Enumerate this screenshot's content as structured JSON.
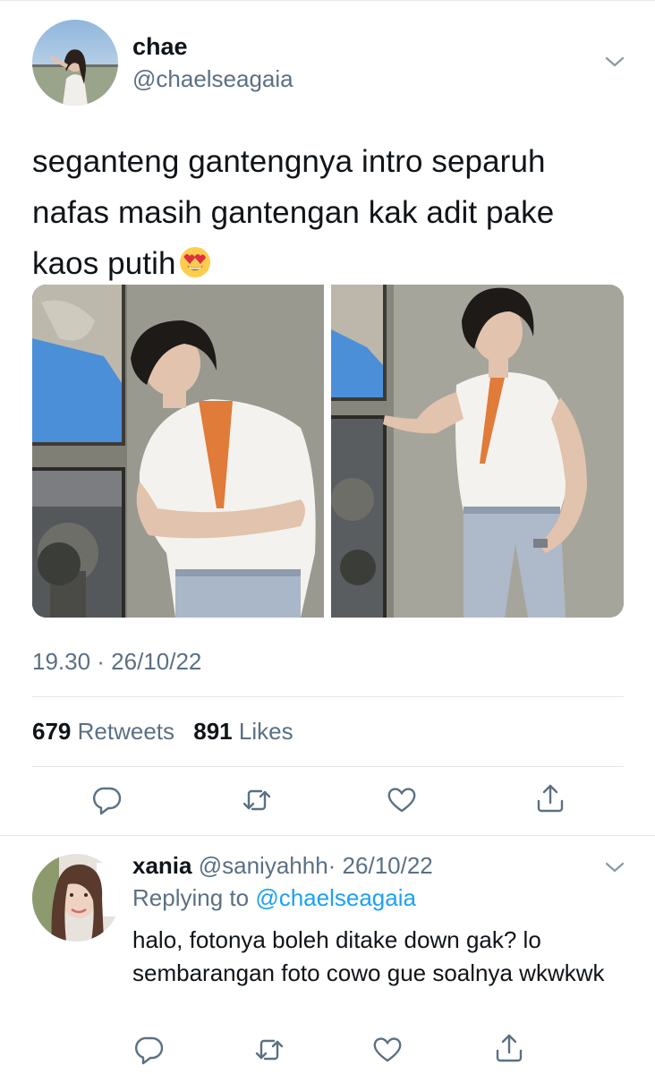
{
  "tweet": {
    "author_name": "chae",
    "author_handle": "@chaelseagaia",
    "text": "seganteng gantengnya intro separuh nafas masih gantengan kak adit pake kaos putih",
    "emoji": "smiling-face-with-heart-eyes",
    "timestamp": "19.30 · 26/10/22",
    "retweets_count": "679",
    "retweets_label": "Retweets",
    "likes_count": "891",
    "likes_label": "Likes"
  },
  "reply": {
    "author_name": "xania",
    "author_handle": "@saniyahhh",
    "date_meta": "· 26/10/22",
    "replying_to_label": "Replying to",
    "replying_to_handle": "@chaelseagaia",
    "text": "halo, fotonya boleh ditake down gak? lo sembarangan foto cowo gue soalnya wkwkwk"
  },
  "icons": [
    "reply-icon",
    "retweet-icon",
    "like-icon",
    "share-icon",
    "chevron-down-icon"
  ],
  "colors": {
    "text_primary": "#0f1419",
    "text_secondary": "#5b7083",
    "link": "#1da1f2",
    "divider": "#e1e6ea"
  }
}
